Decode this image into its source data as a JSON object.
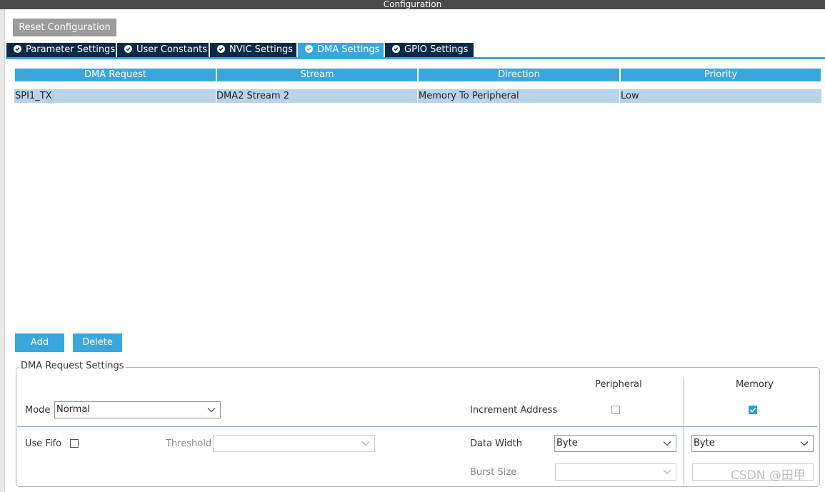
{
  "window": {
    "title": "Configuration"
  },
  "toolbar": {
    "reset_label": "Reset Configuration"
  },
  "tabs": [
    {
      "label": "Parameter Settings",
      "active": false
    },
    {
      "label": "User Constants",
      "active": false
    },
    {
      "label": "NVIC Settings",
      "active": false
    },
    {
      "label": "DMA Settings",
      "active": true
    },
    {
      "label": "GPIO Settings",
      "active": false
    }
  ],
  "table": {
    "headers": [
      "DMA Request",
      "Stream",
      "Direction",
      "Priority"
    ],
    "rows": [
      [
        "SPI1_TX",
        "DMA2 Stream 2",
        "Memory To Peripheral",
        "Low"
      ]
    ]
  },
  "actions": {
    "add_label": "Add",
    "delete_label": "Delete"
  },
  "settings": {
    "group_title": "DMA Request Settings",
    "peripheral_header": "Peripheral",
    "memory_header": "Memory",
    "mode_label": "Mode",
    "mode_value": "Normal",
    "increment_label": "Increment Address",
    "increment_peripheral": false,
    "increment_memory": true,
    "use_fifo_label": "Use Fifo",
    "use_fifo": false,
    "threshold_label": "Threshold",
    "threshold_value": "",
    "data_width_label": "Data Width",
    "data_width_peripheral": "Byte",
    "data_width_memory": "Byte",
    "burst_size_label": "Burst Size",
    "burst_peripheral": "",
    "burst_memory": ""
  },
  "watermark": "CSDN @田甲",
  "colors": {
    "accent": "#3aa6dc",
    "tab_dark": "#0b2a4a",
    "selected_row": "#b9d3e8",
    "title_bar": "#4b4b4b"
  }
}
